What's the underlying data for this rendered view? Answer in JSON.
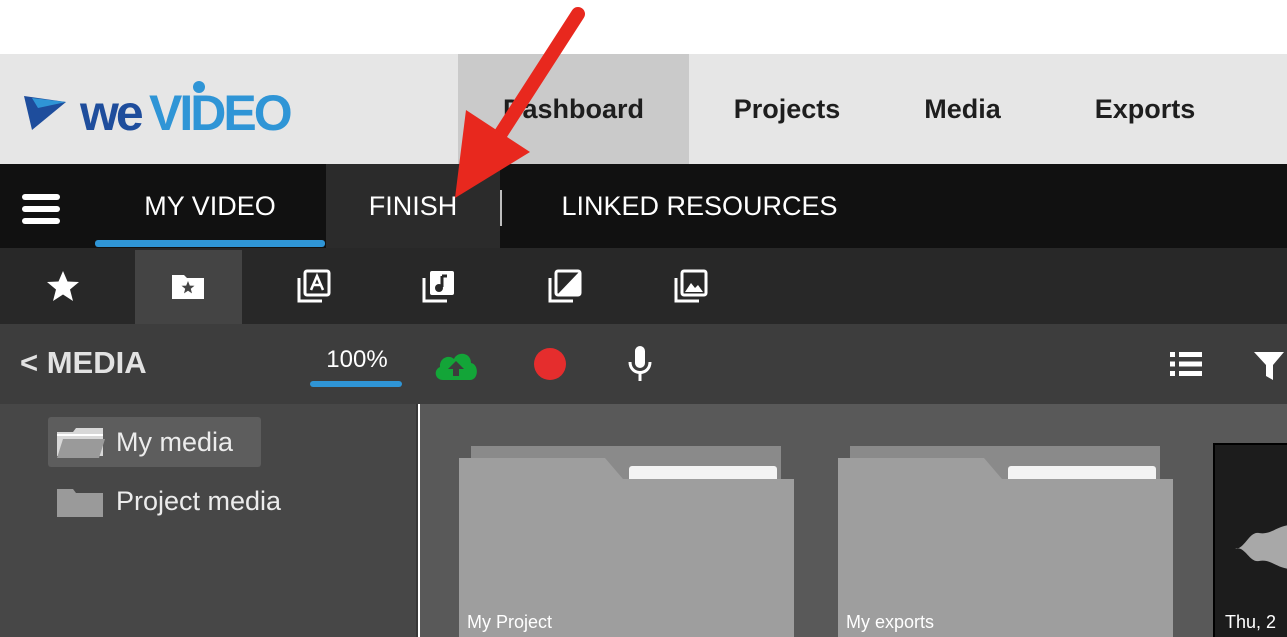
{
  "brand": {
    "logo_text": "WeVideo",
    "accent": "#2f95d6"
  },
  "topnav": {
    "items": [
      {
        "label": "Dashboard",
        "active": true
      },
      {
        "label": "Projects"
      },
      {
        "label": "Media"
      },
      {
        "label": "Exports"
      }
    ]
  },
  "tabs": {
    "menu_icon": "hamburger-menu-icon",
    "items": [
      {
        "label": "MY VIDEO",
        "active": true
      },
      {
        "label": "FINISH"
      },
      {
        "label": "LINKED RESOURCES"
      }
    ]
  },
  "icon_strip": {
    "items": [
      "star-icon",
      "starred-folder-icon",
      "text-library-icon",
      "music-library-icon",
      "transition-library-icon",
      "image-library-icon"
    ],
    "active_index": 1
  },
  "media_toolbar": {
    "title": "MEDIA",
    "back_icon": "chevron-left-icon",
    "zoom": "100%",
    "upload_icon": "cloud-upload-icon",
    "upload_color": "#13a538",
    "record_icon": "record-icon",
    "record_color": "#e52d2d",
    "mic_icon": "microphone-icon",
    "list_view_icon": "list-view-icon",
    "filter_icon": "filter-icon"
  },
  "folder_tree": [
    {
      "label": "My media",
      "icon": "open-folder-icon",
      "selected": true
    },
    {
      "label": "Project media",
      "icon": "folder-icon"
    }
  ],
  "media_items": [
    {
      "label": "My Project",
      "type": "folder"
    },
    {
      "label": "My exports",
      "type": "folder"
    },
    {
      "label": "Thu, 2",
      "type": "audio"
    }
  ],
  "annotation": {
    "type": "arrow",
    "color": "#e8281e"
  }
}
